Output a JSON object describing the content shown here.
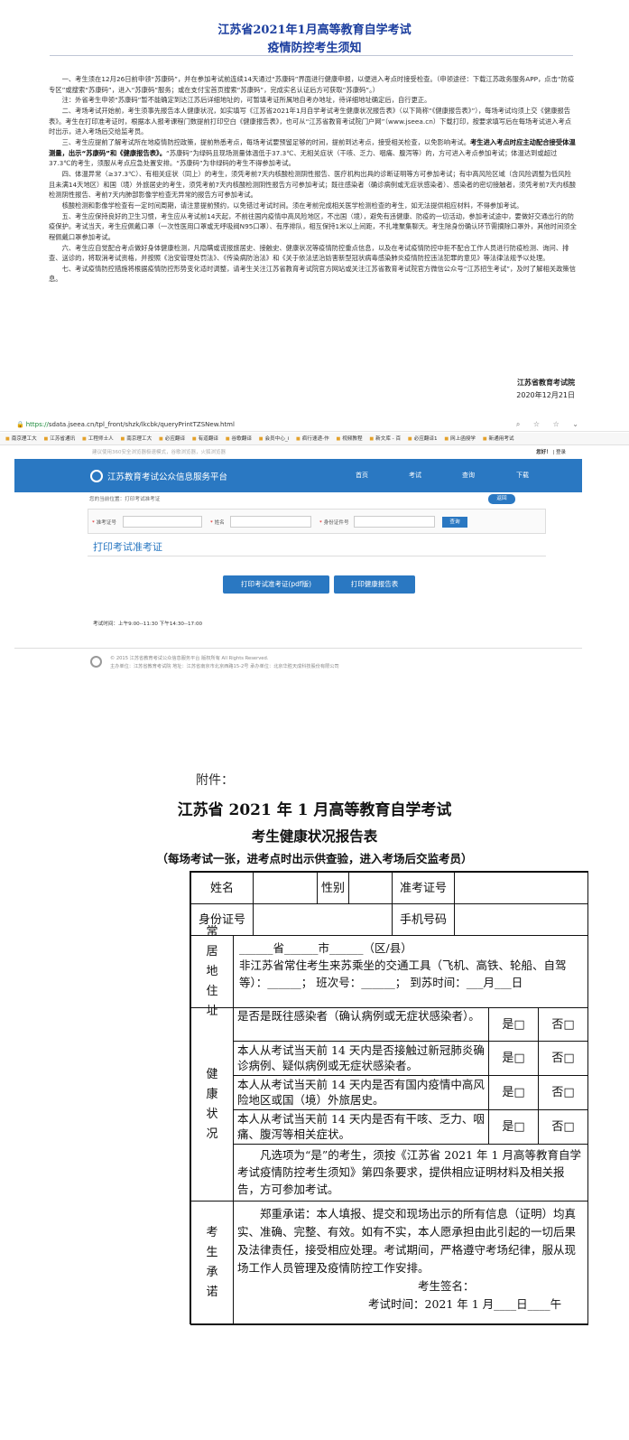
{
  "notice": {
    "title1": "江苏省2021年1月高等教育自学考试",
    "title2": "疫情防控考生须知",
    "p1": "一、考生须在12月26日前申领“苏康码”，并在参加考试前连续14天通过“苏康码”界面进行健康申报，以便进入考点时接受检查。（申领途径：下载江苏政务服务APP，点击“防疫专区”或搜索“苏康码”，进入“苏康码”服务；或在支付宝首页搜索“苏康码”，完成实名认证后方可获取“苏康码”。）",
    "p2": "注：外省考生申领“苏康码”暂不能确定到达江苏后详细地址的，可暂填考证所属地自考办地址，待详细地址确定后，自行更正。",
    "p3": "二、考场考试开始前，考生须事先报告本人健康状况，如实填写《江苏省2021年1月自学考试考生健康状况报告表》（以下简称“《健康报告表》”），每场考试均须上交《健康报告表》。考生在打印准考证时，根据本人报考课程门数提前打印空白《健康报告表》，也可从“江苏省教育考试院门户网”（www.jseea.cn）下载打印，按要求填写后在每场考试进入考点时出示，进入考场后交给监考员。",
    "p4a": "三、考生应提前了解考试所在地疫情防控政策，提前熟悉考点，每场考试要预留足够的时间，提前到达考点，接受相关检查，以免影响考试。",
    "p4b": "考生进入考点时应主动配合接受体温测量，出示“苏康码”和《健康报告表》。",
    "p4c": "“苏康码”为绿码且现场测量体温低于37.3℃、无相关症状（干咳、乏力、咽痛、腹泻等）的，方可进入考点参加考试；体温达到或超过37.3℃的考生，须服从考点应急处置安排。“苏康码”为非绿码的考生不得参加考试。",
    "p5": "四、体温异常（≥37.3℃）、有相关症状（同上）的考生，须凭考前7天内核酸检测阴性报告、医疗机构出具的诊断证明等方可参加考试；有中高风险区域（含风险调整为低风险且未满14天地区）和国（境）外旅居史的考生，须凭考前7天内核酸检测阴性报告方可参加考试；既往感染者（确诊病例或无症状感染者）、感染者的密切接触者，须凭考前7天内核酸检测阴性报告、考前7天内肺部影像学检查无异常的报告方可参加考试。",
    "p6": "核酸检测和影像学检查有一定时间周期，请注意提前预约，以免错过考试时间。须在考前完成相关医学检测检查的考生，如无法提供相应材料，不得参加考试。",
    "p7": "五、考生应保持良好的卫生习惯，考生应从考试前14天起，不前往国内疫情中高风险地区，不出国（境），避免有违健康、防疫的一切活动，参加考试途中，要做好交通出行的防疫保护。考试当天，考生应佩戴口罩（一次性医用口罩或无呼吸阀N95口罩）、有序排队，相互保持1米以上间距，不扎堆聚集聊天。考生除身份确认环节需摘除口罩外，其他时间须全程佩戴口罩参加考试。",
    "p8": "六、考生应自觉配合考点做好身体健康检测，凡隐瞒或谎报旅居史、接触史、健康状况等疫情防控重点信息，以及在考试疫情防控中拒不配合工作人员进行防疫检测、询问、排查、送诊的，将取消考试资格，并按照《治安管理处罚法》、《传染病防治法》和《关于依法惩治妨害新型冠状病毒感染肺炎疫情防控违法犯罪的意见》等法律法规予以处理。",
    "p9": "七、考试疫情防控措施将根据疫情防控形势变化适时调整，请考生关注江苏省教育考试院官方网站或关注江苏省教育考试院官方微信公众号“江苏招生考试”，及时了解相关政策信息。",
    "org": "江苏省教育考试院",
    "date": "2020年12月21日"
  },
  "browser": {
    "url_prefix": "https://",
    "url": "sdata.jseea.cn/tpl_front/shzk/lkcbk/queryPrintTZSNew.html",
    "bookmarks": [
      "南京理工大",
      "江苏省通讯",
      "工程师士人",
      "南京理工大",
      "必应翻译",
      "有道翻译",
      "谷歌翻译",
      "会员中心_i",
      "疯行速递-作",
      "视频教程",
      "新文库 - 百",
      "必应翻译1",
      "网上函授学",
      "新通用考试"
    ]
  },
  "site": {
    "topbar_left": "建议使用360安全浏览器极速模式，谷歌浏览器，火狐浏览器",
    "greeting": "您好！",
    "login": "登录",
    "name": "江苏教育考试公众信息服务平台",
    "nav": [
      "首页",
      "考试",
      "查询",
      "下载"
    ],
    "breadcrumb": "您的当前位置：打印考试准考证",
    "back": "返回",
    "labels": {
      "admission": "准考证号",
      "name": "姓名",
      "idcard": "身份证件号"
    },
    "required": "*",
    "search": "查询",
    "section_title": "打印考试准考证",
    "btn_print_pdf": "打印考试准考证(pdf版)",
    "btn_print_health": "打印健康报告表",
    "exam_time": "考试时间：上午9:00--11:30 下午14:30--17:00",
    "footer1": "© 2015 江苏省教育考试公众信息服务平台 版权所有 All Rights Reserved.",
    "footer2": "主办单位：江苏省教育考试院 地址：江苏省南京市北京西路15-2号 承办单位：北京华胜天成科技股份有限公司"
  },
  "form": {
    "attachment": "附件：",
    "title1": "江苏省 2021 年 1 月高等教育自学考试",
    "title2": "考生健康状况报告表",
    "note": "（每场考试一张，进考点时出示供查验，进入考场后交监考员）",
    "name": "姓名",
    "gender": "性别",
    "admission_no": "准考证号",
    "id_no": "身份证号",
    "phone": "手机号码",
    "residence": "常居地住址",
    "addr_line1": "______省______市______（区/县）",
    "addr_line2": "非江苏省常住考生来苏乘坐的交通工具（飞机、高铁、轮船、自驾等）：______；  班次号：______；  到苏时间：___月___日",
    "health": "健康状况",
    "q1": "是否是既往感染者（确认病例或无症状感染者）。",
    "q2": "本人从考试当天前 14 天内是否接触过新冠肺炎确诊病例、疑似病例或无症状感染者。",
    "q3": "本人从考试当天前 14 天内是否有国内疫情中高风险地区或国（境）外旅居史。",
    "q4": "本人从考试当天前 14 天内是否有干咳、乏力、咽痛、腹泻等相关症状。",
    "yes": "是□",
    "no": "否□",
    "health_note": "凡选项为“是”的考生，须按《江苏省 2021 年 1 月高等教育自学考试疫情防控考生须知》第四条要求，提供相应证明材料及相关报告，方可参加考试。",
    "promise": "考生承诺",
    "promise_text": "郑重承诺：本人填报、提交和现场出示的所有信息（证明）均真实、准确、完整、有效。如有不实，本人愿承担由此引起的一切后果及法律责任，接受相应处理。考试期间，严格遵守考场纪律，服从现场工作人员管理及疫情防控工作安排。",
    "signature": "考生签名：",
    "exam_time": "考试时间：2021 年 1 月____日____午"
  }
}
